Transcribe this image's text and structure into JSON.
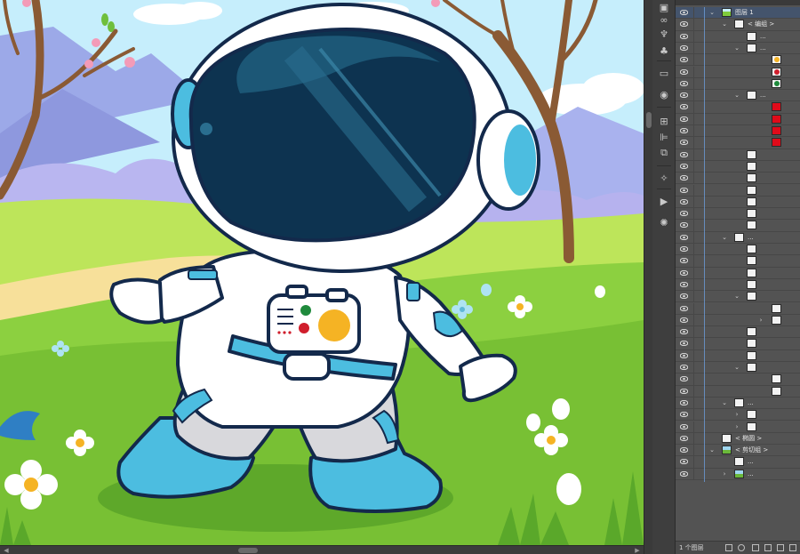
{
  "layers_panel": {
    "rows": [
      {
        "label": "图层 1",
        "indent": 1,
        "chevron": "down",
        "thumb": "layer",
        "active": true
      },
      {
        "label": "< 编组 >",
        "indent": 2,
        "chevron": "down",
        "thumb": "mini"
      },
      {
        "label": "...",
        "indent": 3,
        "chevron": "",
        "thumb": "mini"
      },
      {
        "label": "...",
        "indent": 3,
        "chevron": "down",
        "thumb": "mini"
      },
      {
        "label": "",
        "indent": 4,
        "chevron": "",
        "thumb": "dot",
        "color": "#f5b324"
      },
      {
        "label": "",
        "indent": 4,
        "chevron": "",
        "thumb": "dot",
        "color": "#d01e2c"
      },
      {
        "label": "",
        "indent": 4,
        "chevron": "",
        "thumb": "dot",
        "color": "#1f8a3c"
      },
      {
        "label": "...",
        "indent": 3,
        "chevron": "down",
        "thumb": "mini"
      },
      {
        "label": "",
        "indent": 4,
        "chevron": "",
        "thumb": "red"
      },
      {
        "label": "",
        "indent": 4,
        "chevron": "",
        "thumb": "red"
      },
      {
        "label": "",
        "indent": 4,
        "chevron": "",
        "thumb": "red"
      },
      {
        "label": "",
        "indent": 4,
        "chevron": "",
        "thumb": "red"
      },
      {
        "label": "",
        "indent": 3,
        "chevron": "",
        "thumb": "mini"
      },
      {
        "label": "",
        "indent": 3,
        "chevron": "",
        "thumb": "mini"
      },
      {
        "label": "",
        "indent": 3,
        "chevron": "",
        "thumb": "mini"
      },
      {
        "label": "",
        "indent": 3,
        "chevron": "",
        "thumb": "mini"
      },
      {
        "label": "",
        "indent": 3,
        "chevron": "",
        "thumb": "mini"
      },
      {
        "label": "",
        "indent": 3,
        "chevron": "",
        "thumb": "mini"
      },
      {
        "label": "",
        "indent": 3,
        "chevron": "",
        "thumb": "mini"
      },
      {
        "label": "...",
        "indent": 2,
        "chevron": "down",
        "thumb": "mini"
      },
      {
        "label": "",
        "indent": 3,
        "chevron": "",
        "thumb": "mini"
      },
      {
        "label": "",
        "indent": 3,
        "chevron": "",
        "thumb": "mini"
      },
      {
        "label": "",
        "indent": 3,
        "chevron": "",
        "thumb": "mini"
      },
      {
        "label": "",
        "indent": 3,
        "chevron": "",
        "thumb": "mini"
      },
      {
        "label": "",
        "indent": 3,
        "chevron": "down",
        "thumb": "mini"
      },
      {
        "label": "",
        "indent": 4,
        "chevron": "",
        "thumb": "mini"
      },
      {
        "label": "",
        "indent": 4,
        "chevron": "right",
        "thumb": "mini"
      },
      {
        "label": "",
        "indent": 3,
        "chevron": "",
        "thumb": "mini"
      },
      {
        "label": "",
        "indent": 3,
        "chevron": "",
        "thumb": "mini"
      },
      {
        "label": "",
        "indent": 3,
        "chevron": "",
        "thumb": "mini"
      },
      {
        "label": "",
        "indent": 3,
        "chevron": "down",
        "thumb": "mini"
      },
      {
        "label": "",
        "indent": 4,
        "chevron": "",
        "thumb": "mini"
      },
      {
        "label": "",
        "indent": 4,
        "chevron": "",
        "thumb": "mini"
      },
      {
        "label": "...",
        "indent": 2,
        "chevron": "down",
        "thumb": "mini"
      },
      {
        "label": "",
        "indent": 3,
        "chevron": "right",
        "thumb": "mini"
      },
      {
        "label": "",
        "indent": 3,
        "chevron": "right",
        "thumb": "mini"
      },
      {
        "label": "< 椭圆 >",
        "indent": 1,
        "chevron": "",
        "thumb": "mini"
      },
      {
        "label": "< 剪切组 >",
        "indent": 1,
        "chevron": "down",
        "thumb": "image"
      },
      {
        "label": "...",
        "indent": 2,
        "chevron": "",
        "thumb": "mini"
      },
      {
        "label": "...",
        "indent": 2,
        "chevron": "right",
        "thumb": "image"
      }
    ],
    "footer_count": "1 个图层"
  },
  "tools": [
    "artboard-icon",
    "link-icon",
    "puppet-icon",
    "club-icon",
    "gradient-icon",
    "symbol-icon",
    "transform-icon",
    "align-icon",
    "pathfinder-icon",
    "wand-icon",
    "play-icon",
    "sun-icon"
  ],
  "colors": {
    "accent": "#6b9bd8",
    "panel": "#535353",
    "sky": "#c4eefc",
    "grass": "#7fcb3c",
    "suit_blue": "#4cbde0",
    "visor": "#0d3350"
  }
}
